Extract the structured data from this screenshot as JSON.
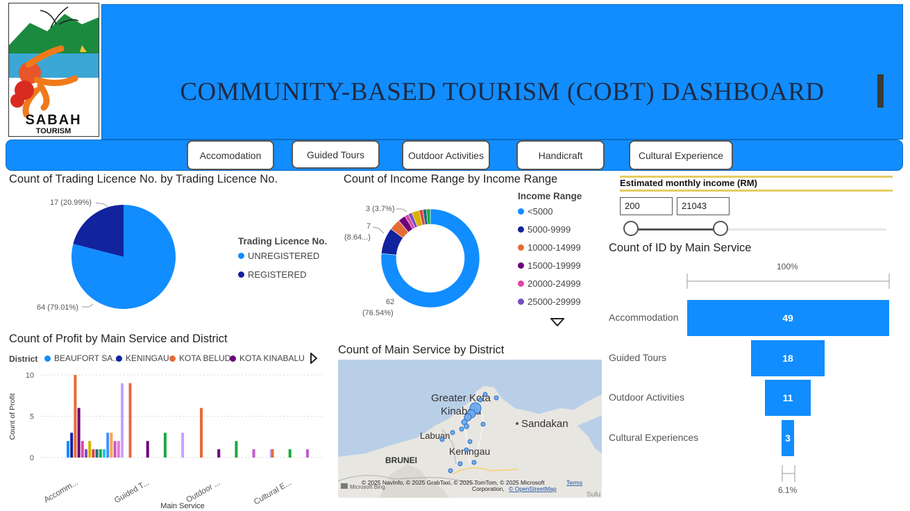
{
  "header": {
    "title": "COMMUNITY-BASED TOURISM (COBT) DASHBOARD",
    "logo_text_1": "SABAH",
    "logo_text_2": "TOURISM"
  },
  "nav": {
    "buttons": [
      "Accomodation",
      "Guided Tours",
      "Outdoor Activities",
      "Handicraft",
      "Cultural Experience"
    ]
  },
  "pie_licence": {
    "title": "Count of Trading Licence No. by Trading Licence No.",
    "legend_title": "Trading Licence No.",
    "labels": [
      "17 (20.99%)",
      "64 (79.01%)"
    ]
  },
  "donut_income": {
    "title": "Count of Income Range by Income Range",
    "legend_title": "Income Range",
    "label_3": "3 (3.7%)",
    "label_7a": "7",
    "label_7b": "(8.64...)",
    "label_62a": "62",
    "label_62b": "(76.54%)"
  },
  "slicer": {
    "title": "Estimated monthly income (RM)",
    "min_value": "200",
    "max_value": "21043",
    "level_fraction": 0.365
  },
  "funnel": {
    "title": "Count of ID by Main Service",
    "top_label": "100%",
    "bottom_label": "6.1%"
  },
  "profit_chart": {
    "title": "Count of Profit by Main Service and District",
    "legend_title": "District",
    "legend_items": [
      "BEAUFORT SA...",
      "KENINGAU",
      "KOTA BELUD",
      "KOTA KINABALU"
    ],
    "xlabel": "Main Service",
    "ylabel": "Count of Profit",
    "yticks": [
      "10",
      "5",
      "0"
    ],
    "xticks": [
      "Accomm...",
      "Guided T...",
      "Outdoor ...",
      "Cultural E..."
    ]
  },
  "map": {
    "title": "Count of Main Service by District",
    "places": [
      "Greater Kota",
      "Kinabalu",
      "Sandakan",
      "Labuan",
      "Keningau",
      "BRUNEI",
      "Sulu"
    ],
    "attribution": "© 2025 NavInfo, © 2025 GrabTaxi, © 2025 TomTom, © 2025 Microsoft",
    "attribution2": "Corporation,",
    "terms": "Terms",
    "osm": "© OpenStreetMap",
    "bing": "Microsoft Bing"
  },
  "chart_data": [
    {
      "type": "pie",
      "title": "Count of Trading Licence No. by Trading Licence No.",
      "legend_title": "Trading Licence No.",
      "categories": [
        "UNREGISTERED",
        "REGISTERED"
      ],
      "values": [
        64,
        17
      ],
      "colors": [
        "#118dff",
        "#12239e"
      ],
      "legend": "right"
    },
    {
      "type": "pie",
      "subtype": "donut",
      "title": "Count of Income Range by Income Range",
      "legend_title": "Income Range",
      "categories": [
        "<5000",
        "5000-9999",
        "10000-14999",
        "15000-19999",
        "20000-24999",
        "25000-29999"
      ],
      "values": [
        62,
        7,
        3,
        2,
        1,
        1
      ],
      "extra_slices": [
        2,
        1,
        1,
        1
      ],
      "colors": [
        "#118dff",
        "#12239e",
        "#e66c37",
        "#6b007b",
        "#e044a7",
        "#744ec2"
      ],
      "extra_colors": [
        "#d9b300",
        "#d64550",
        "#197278",
        "#1aab40"
      ],
      "legend": "right"
    },
    {
      "type": "bar",
      "subtype": "funnel",
      "title": "Count of ID by Main Service",
      "categories": [
        "Accommodation",
        "Guided Tours",
        "Outdoor Activities",
        "Cultural Experiences"
      ],
      "values": [
        49,
        18,
        11,
        3
      ],
      "color": "#118dff"
    },
    {
      "type": "bar",
      "title": "Count of Profit by Main Service and District",
      "xlabel": "Main Service",
      "ylabel": "Count of Profit",
      "ylim": [
        0,
        10
      ],
      "legend_title": "District",
      "categories": [
        "Accomm...",
        "Guided T...",
        "Outdoor ...",
        "Cultural E..."
      ],
      "series": [
        {
          "name": "BEAUFORT SA...",
          "color": "#118dff",
          "values": [
            2,
            0,
            0,
            0
          ]
        },
        {
          "name": "KENINGAU",
          "color": "#12239e",
          "values": [
            3,
            0,
            0,
            0
          ]
        },
        {
          "name": "KOTA BELUD",
          "color": "#e66c37",
          "values": [
            10,
            9,
            6,
            1
          ]
        },
        {
          "name": "KOTA KINABALU",
          "color": "#6b007b",
          "values": [
            6,
            2,
            1,
            0
          ]
        },
        {
          "color": "#e044a7",
          "values": [
            2,
            0,
            0,
            0
          ]
        },
        {
          "color": "#744ec2",
          "values": [
            1,
            0,
            0,
            0
          ]
        },
        {
          "color": "#d9b300",
          "values": [
            2,
            0,
            0,
            0
          ]
        },
        {
          "color": "#d64550",
          "values": [
            1,
            0,
            0,
            0
          ]
        },
        {
          "color": "#197278",
          "values": [
            1,
            0,
            0,
            0
          ]
        },
        {
          "color": "#1aab40",
          "values": [
            1,
            3,
            2,
            1
          ]
        },
        {
          "color": "#15c6f4",
          "values": [
            1,
            0,
            0,
            0
          ]
        },
        {
          "color": "#4092ff",
          "values": [
            3,
            0,
            0,
            0
          ]
        },
        {
          "color": "#ffa058",
          "values": [
            3,
            0,
            0,
            0
          ]
        },
        {
          "color": "#be5dc9",
          "values": [
            2,
            0,
            1,
            1
          ]
        },
        {
          "color": "#f472d0",
          "values": [
            2,
            0,
            0,
            0
          ]
        },
        {
          "color": "#c5a4ff",
          "values": [
            9,
            3,
            1,
            0
          ]
        }
      ]
    }
  ]
}
